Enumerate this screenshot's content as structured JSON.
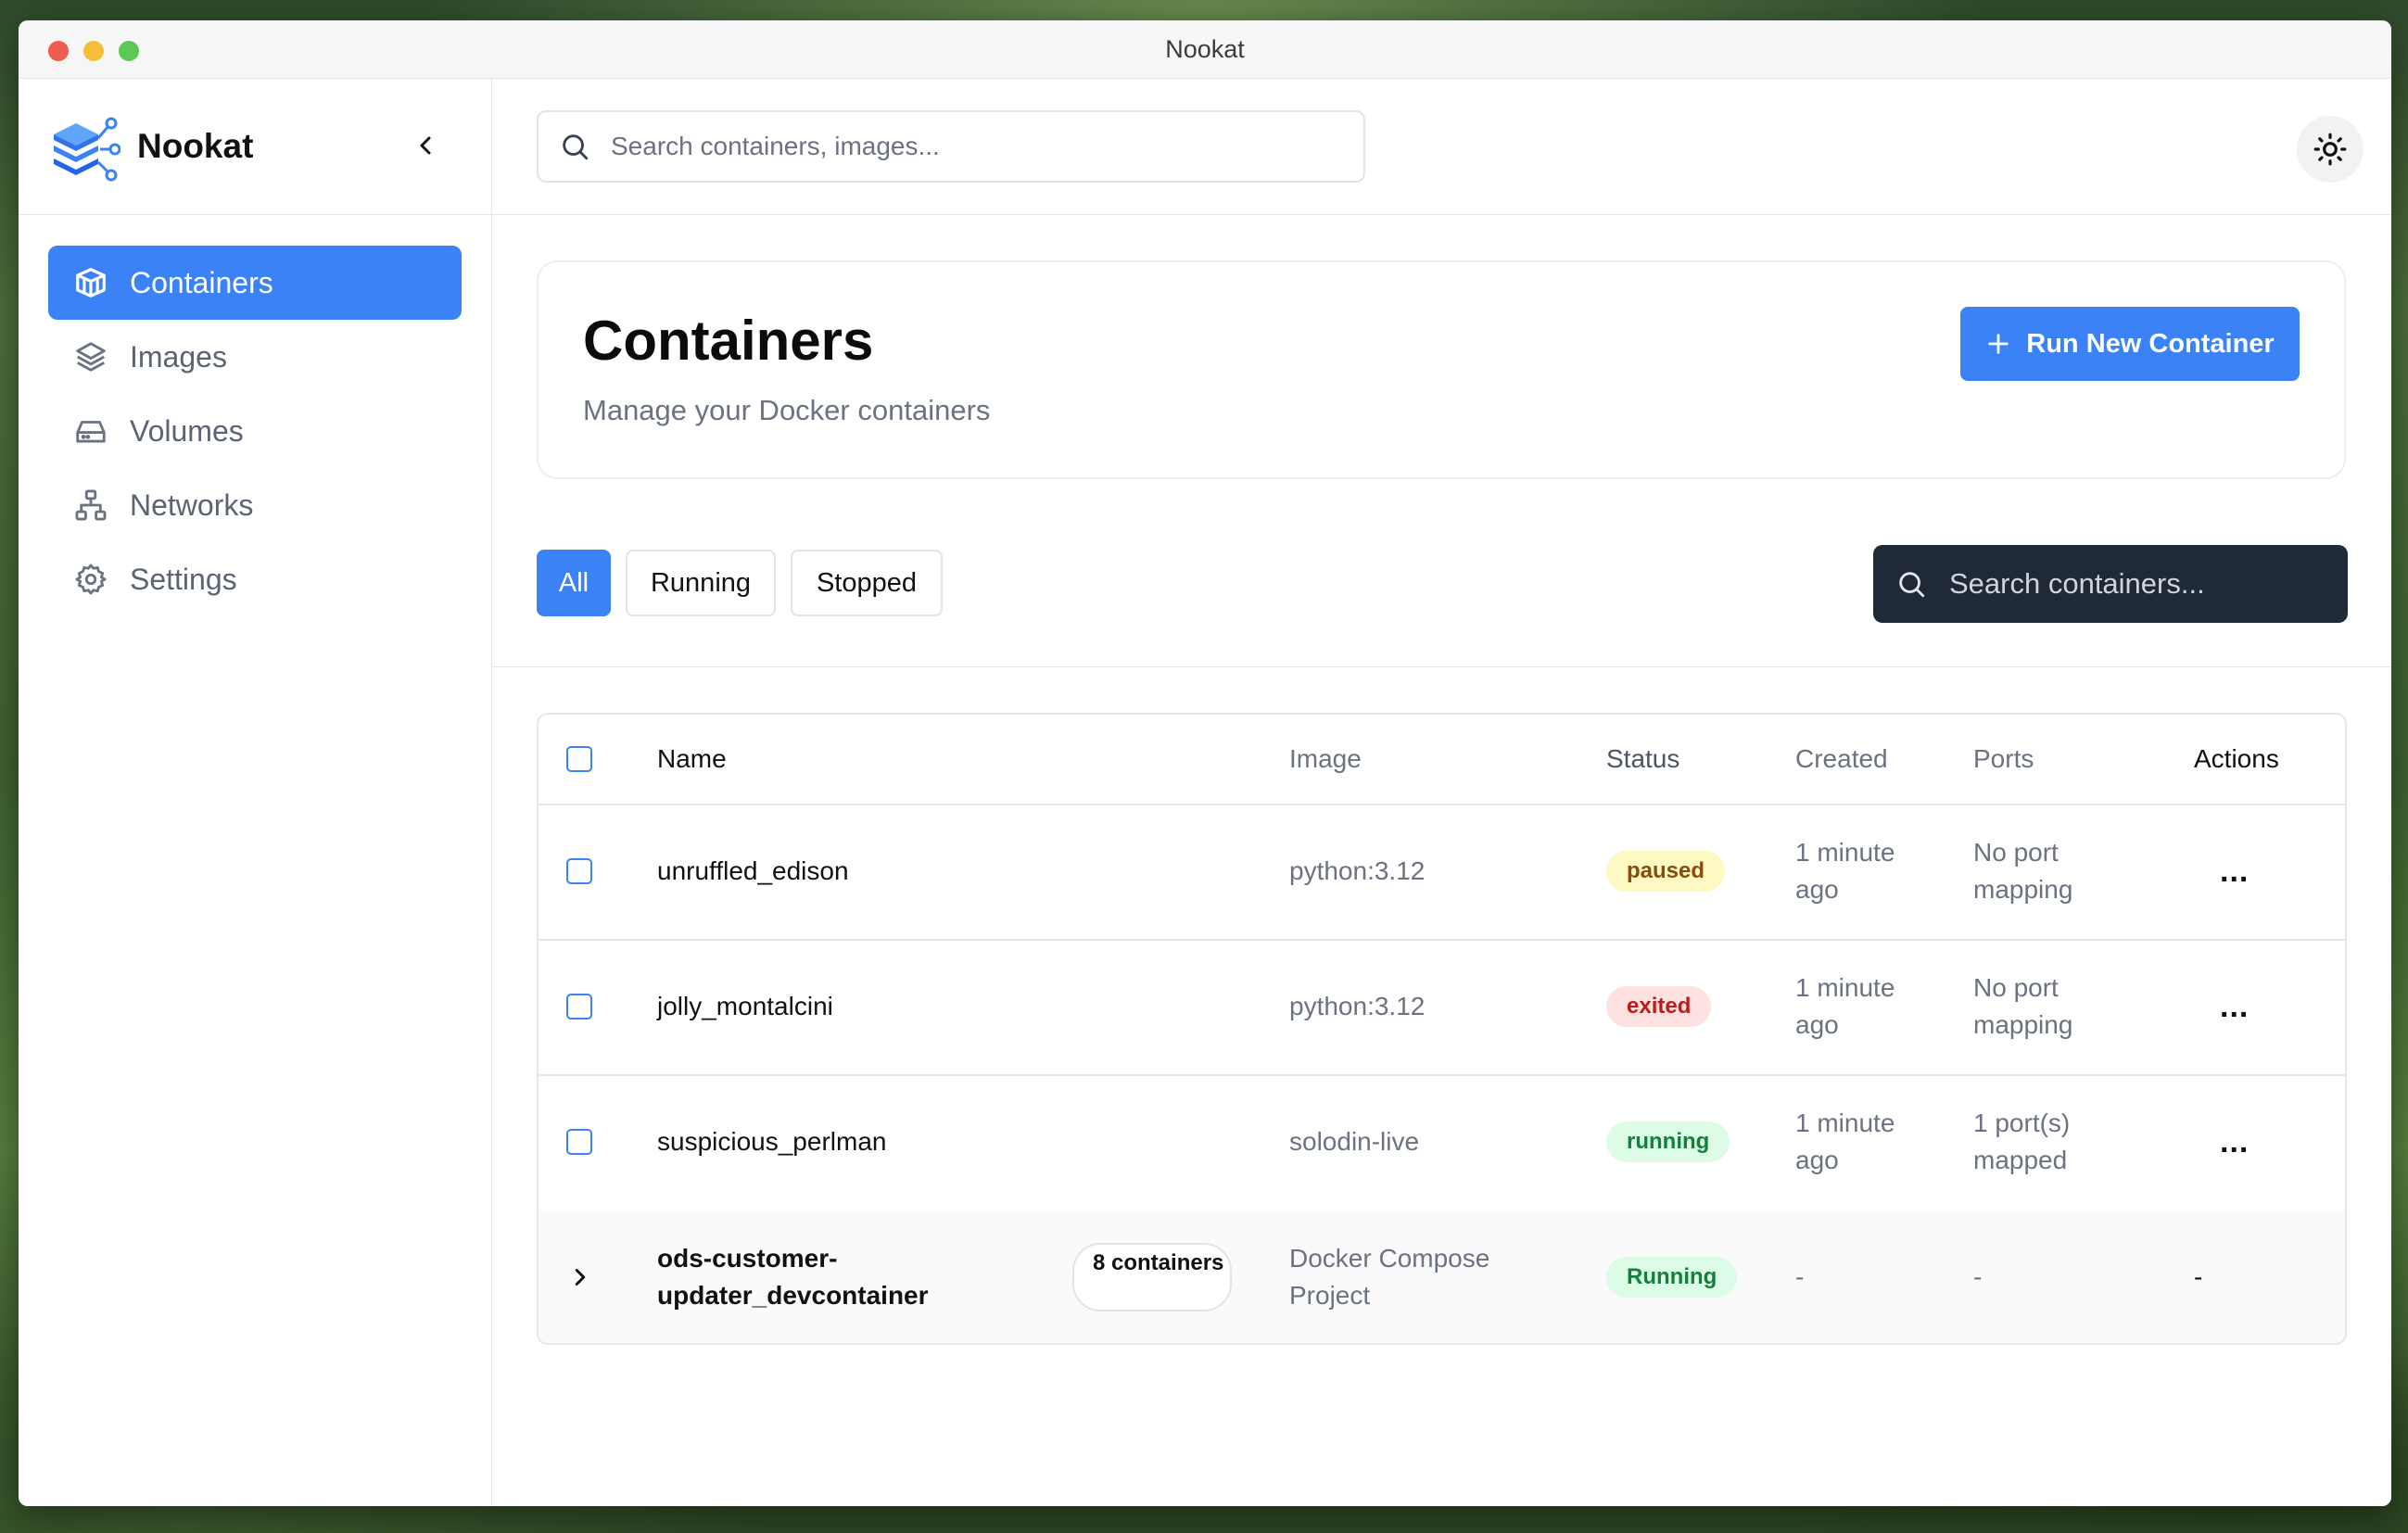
{
  "window": {
    "title": "Nookat"
  },
  "sidebar": {
    "brand": "Nookat",
    "items": [
      {
        "label": "Containers",
        "icon": "box-icon",
        "active": true
      },
      {
        "label": "Images",
        "icon": "layers-icon",
        "active": false
      },
      {
        "label": "Volumes",
        "icon": "hard-drive-icon",
        "active": false
      },
      {
        "label": "Networks",
        "icon": "network-icon",
        "active": false
      },
      {
        "label": "Settings",
        "icon": "gear-icon",
        "active": false
      }
    ]
  },
  "topbar": {
    "search_placeholder": "Search containers, images..."
  },
  "header": {
    "title": "Containers",
    "subtitle": "Manage your Docker containers",
    "run_button": "Run New Container"
  },
  "filters": {
    "all": "All",
    "running": "Running",
    "stopped": "Stopped",
    "active": "All"
  },
  "container_search": {
    "placeholder": "Search containers..."
  },
  "table": {
    "columns": {
      "name": "Name",
      "image": "Image",
      "status": "Status",
      "created": "Created",
      "ports": "Ports",
      "actions": "Actions"
    },
    "rows": [
      {
        "name": "unruffled_edison",
        "image": "python:3.12",
        "status": "paused",
        "created": "1 minute ago",
        "ports": "No port mapping",
        "actions": "..."
      },
      {
        "name": "jolly_montalcini",
        "image": "python:3.12",
        "status": "exited",
        "created": "1 minute ago",
        "ports": "No port mapping",
        "actions": "..."
      },
      {
        "name": "suspicious_perlman",
        "image": "solodin-live",
        "status": "running",
        "created": "1 minute ago",
        "ports": "1 port(s) mapped",
        "actions": "..."
      }
    ],
    "group": {
      "name": "ods-customer-updater_devcontainer",
      "count_label": "8 containers",
      "image": "Docker Compose Project",
      "status": "Running",
      "created": "-",
      "ports": "-",
      "actions": "-"
    }
  },
  "colors": {
    "accent": "#3b82f6",
    "dark_search": "#1f2937",
    "paused": "#fef9c3",
    "exited": "#fee2e2",
    "running": "#dcfce7"
  }
}
